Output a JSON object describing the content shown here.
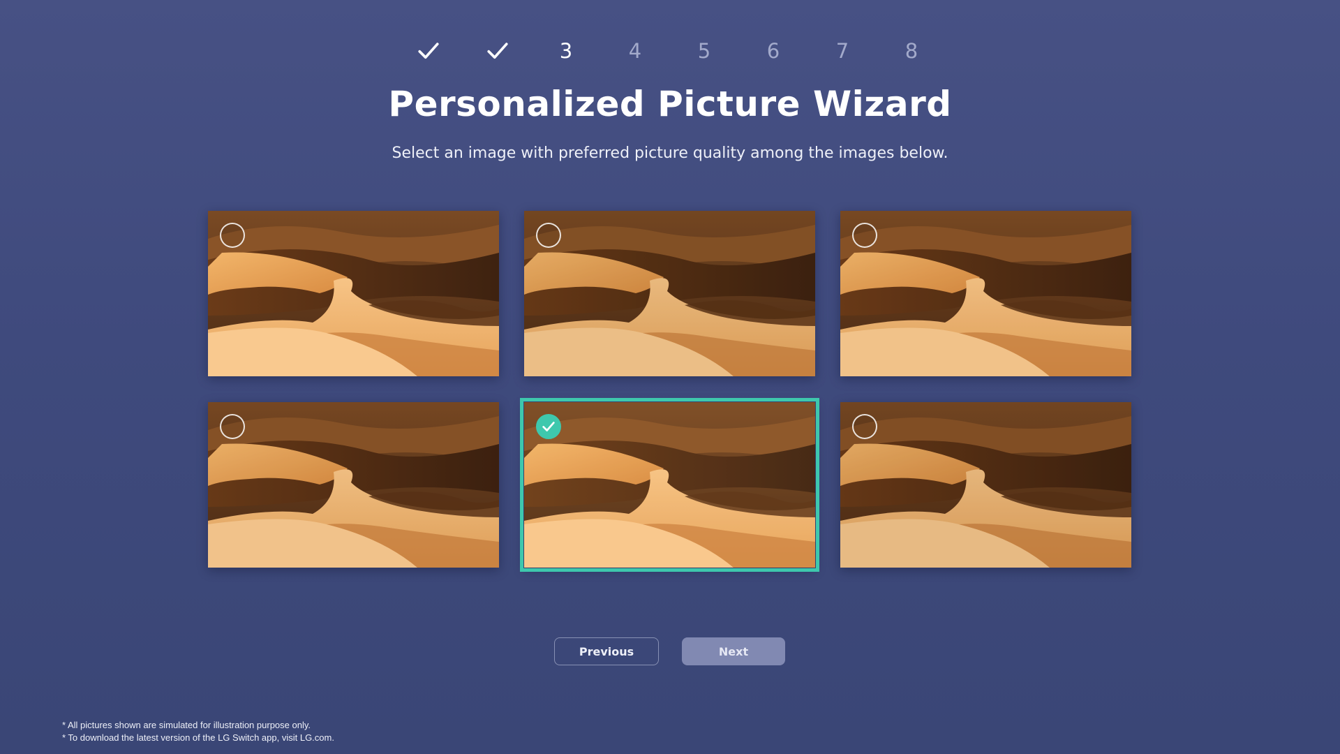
{
  "steps": [
    {
      "label": "",
      "state": "done",
      "icon": "checkmark-icon"
    },
    {
      "label": "",
      "state": "done",
      "icon": "checkmark-icon"
    },
    {
      "label": "3",
      "state": "current"
    },
    {
      "label": "4",
      "state": "pending"
    },
    {
      "label": "5",
      "state": "pending"
    },
    {
      "label": "6",
      "state": "pending"
    },
    {
      "label": "7",
      "state": "pending"
    },
    {
      "label": "8",
      "state": "pending"
    }
  ],
  "title": "Personalized Picture Wizard",
  "subtitle": "Select an image with preferred picture quality among the images below.",
  "options": [
    {
      "selected": false,
      "radio_icon": "radio-unchecked-icon"
    },
    {
      "selected": false,
      "radio_icon": "radio-unchecked-icon"
    },
    {
      "selected": false,
      "radio_icon": "radio-unchecked-icon"
    },
    {
      "selected": false,
      "radio_icon": "radio-unchecked-icon"
    },
    {
      "selected": true,
      "radio_icon": "radio-checked-icon"
    },
    {
      "selected": false,
      "radio_icon": "radio-unchecked-icon"
    }
  ],
  "buttons": {
    "previous": "Previous",
    "next": "Next"
  },
  "footnotes": [
    "* All pictures shown are simulated for illustration purpose only.",
    "* To download the latest version of the LG Switch app, visit LG.com."
  ],
  "colors": {
    "background": "#434d80",
    "accent": "#3ec8ad",
    "next_button": "#8189b2",
    "step_pending": "#a3aacb"
  }
}
